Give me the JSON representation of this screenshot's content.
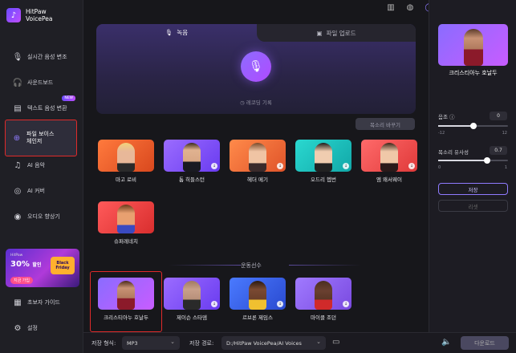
{
  "app": {
    "name_line1": "HitPaw",
    "name_line2": "VoicePea"
  },
  "sidebar": {
    "items": [
      {
        "label": "실시간 음성 변조",
        "icon": "mic-icon"
      },
      {
        "label": "사운드보드",
        "icon": "headphones-icon"
      },
      {
        "label": "텍스트 음성 변환",
        "icon": "text-icon",
        "badge": "NEW"
      },
      {
        "label_line1": "파일 보이스",
        "label_line2": "체인저",
        "icon": "file-voice-icon"
      },
      {
        "label": "AI 음악",
        "icon": "music-icon"
      },
      {
        "label": "AI 커버",
        "icon": "cover-icon"
      },
      {
        "label": "오디오 향상기",
        "icon": "enhance-icon"
      },
      {
        "label": "초보자 가이드",
        "icon": "guide-icon"
      },
      {
        "label": "설정",
        "icon": "gear-icon"
      }
    ],
    "promo": {
      "brand": "HitPaw",
      "discount": "30%",
      "discount_suffix": "할인",
      "cta": "지금 가입",
      "badge": "Black Friday"
    }
  },
  "topbar": {
    "icons": [
      "book-icon",
      "discord-icon",
      "user-icon",
      "menu-icon",
      "minimize-icon",
      "maximize-icon",
      "close-icon"
    ]
  },
  "recorder": {
    "tab_record": "녹음",
    "tab_upload": "파일 업로드",
    "history": "레코딩 기록"
  },
  "change_button": "목소리 바꾸기",
  "voices_row1": [
    {
      "name": "마고 로비",
      "bg": "#f2602e"
    },
    {
      "name": "톰 히들스턴",
      "bg": "#8b5cff"
    },
    {
      "name": "헤더 메기",
      "bg": "#ff6b3a"
    },
    {
      "name": "오드리 헵번",
      "bg": "#22c8c8"
    },
    {
      "name": "엠 왜서웨이",
      "bg": "#ff5b5b"
    }
  ],
  "voices_row2": [
    {
      "name": "슈퍼레네치",
      "bg": "#ff4e4e"
    }
  ],
  "section_title": "운동선수",
  "athletes": [
    {
      "name": "크리스티아누 호날두",
      "bg": "#8a6cff"
    },
    {
      "name": "제이슨 스타뎀",
      "bg": "#8a6cff"
    },
    {
      "name": "르브론 제임스",
      "bg": "#3c6cff"
    },
    {
      "name": "마이클 조던",
      "bg": "#9a6cff"
    }
  ],
  "right_panel": {
    "selected_name": "크리스티아누 호날두",
    "pitch_label": "음조",
    "pitch_value": "0",
    "pitch_min": "-12",
    "pitch_max": "12",
    "pitch_level": 0.5,
    "similarity_label": "목소리 유사성",
    "similarity_value": "0.7",
    "similarity_min": "0",
    "similarity_max": "1",
    "similarity_level": 0.7,
    "save_button": "저장",
    "reset_button": "리셋"
  },
  "bottom": {
    "format_label": "저장 형식:",
    "format_value": "MP3",
    "path_label": "저장 경로:",
    "path_value": "D:/HitPaw VoicePea/AI Voices",
    "export_button": "다운로드"
  }
}
